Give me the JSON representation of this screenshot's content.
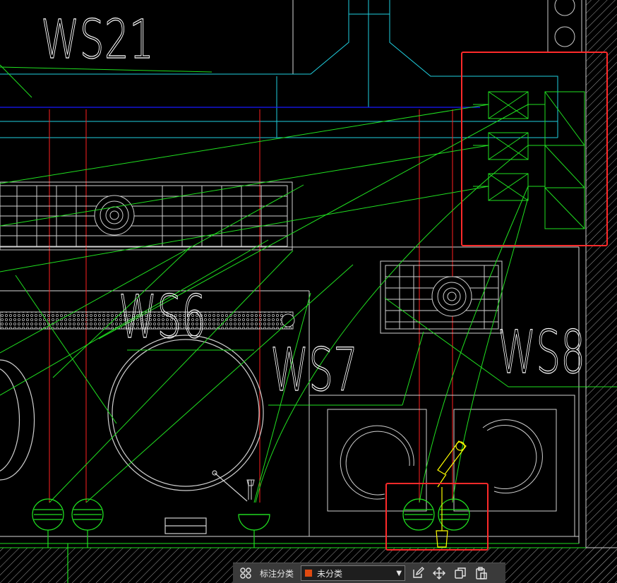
{
  "drawing": {
    "labels": {
      "ws21": "WS21",
      "ws6": "WS6",
      "ws7": "WS7",
      "ws8": "WS8"
    },
    "colors": {
      "background": "#000000",
      "red_line": "#ff2020",
      "green_line": "#20e020",
      "cyan_line": "#20d0e0",
      "blue_line": "#1818ff",
      "white_line": "#d8d8d8",
      "yellow_line": "#ffff00",
      "highlight_box": "#ff2a2a"
    }
  },
  "toolbar": {
    "category_label": "标注分类",
    "category_value": "未分类",
    "category_color": "#e04a10",
    "icons": [
      "grid-icon",
      "edit-icon",
      "move-icon",
      "copy-icon",
      "paste-icon"
    ]
  }
}
